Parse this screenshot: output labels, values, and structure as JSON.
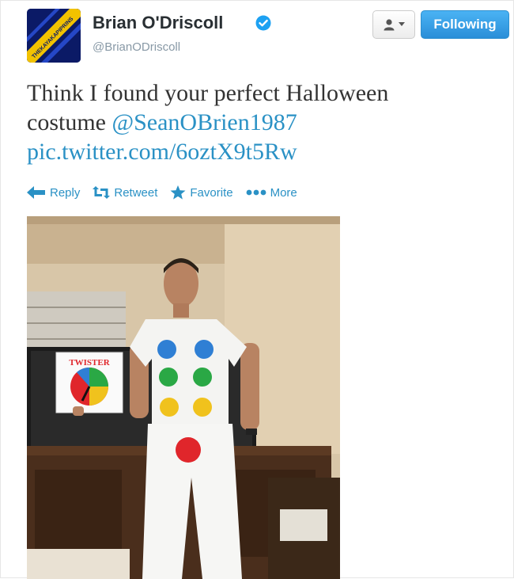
{
  "header": {
    "avatar_text": "THEKAYAKAPIPRINS",
    "name": "Brian O'Driscoll",
    "handle": "@BrianODriscoll",
    "verified_icon": "verified-badge-icon",
    "follow_label": "Following"
  },
  "tweet": {
    "line1": "Think I found your perfect Halloween",
    "line2_text": "costume ",
    "mention": "@SeanOBrien1987",
    "pic_link": "pic.twitter.com/6oztX9t5Rw"
  },
  "actions": [
    {
      "label": "Reply",
      "icon": "reply-icon"
    },
    {
      "label": "Retweet",
      "icon": "retweet-icon"
    },
    {
      "label": "Favorite",
      "icon": "star-icon"
    },
    {
      "label": "More",
      "icon": "more-dots-icon"
    }
  ],
  "photo": {
    "board_title": "TWISTER"
  },
  "colors": {
    "link": "#2a91c5",
    "follow_button": "#2a8ed8",
    "verified": "#1da1f2"
  }
}
